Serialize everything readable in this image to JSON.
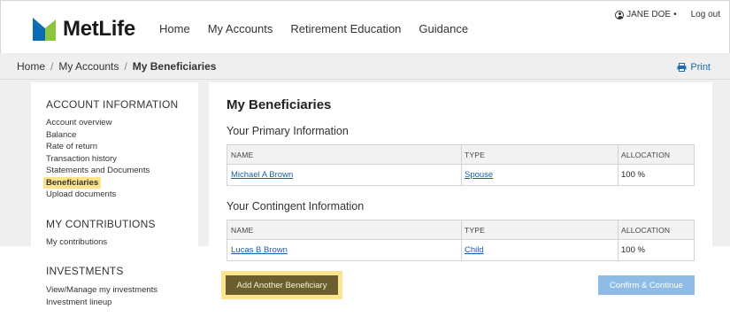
{
  "brand": {
    "name": "MetLife",
    "primary_blue": "#0a6bb4",
    "green": "#8bc63e"
  },
  "nav": {
    "items": [
      "Home",
      "My Accounts",
      "Retirement Education",
      "Guidance"
    ]
  },
  "user": {
    "name": "JANE DOE",
    "name_suffix": "•",
    "logout": "Log out"
  },
  "breadcrumb": {
    "home": "Home",
    "sep1": "/",
    "accounts": "My Accounts",
    "sep2": "/",
    "current": "My Beneficiaries"
  },
  "print_label": "Print",
  "sidebar": {
    "sections": [
      {
        "heading": "ACCOUNT INFORMATION",
        "items": [
          "Account overview",
          "Balance",
          "Rate of return",
          "Transaction history",
          "Statements and Documents",
          "Beneficiaries",
          "Upload documents"
        ],
        "active": "Beneficiaries"
      },
      {
        "heading": "MY CONTRIBUTIONS",
        "items": [
          "My contributions"
        ]
      },
      {
        "heading": "INVESTMENTS",
        "items": [
          "View/Manage my investments",
          "Investment lineup"
        ]
      }
    ]
  },
  "main": {
    "title": "My Beneficiaries",
    "primary": {
      "heading": "Your Primary Information",
      "columns": [
        "NAME",
        "TYPE",
        "ALLOCATION"
      ],
      "rows": [
        {
          "name": "Michael A Brown",
          "type": "Spouse",
          "allocation": "100 %"
        }
      ]
    },
    "contingent": {
      "heading": "Your Contingent Information",
      "columns": [
        "NAME",
        "TYPE",
        "ALLOCATION"
      ],
      "rows": [
        {
          "name": "Lucas B Brown",
          "type": "Child",
          "allocation": "100 %"
        }
      ]
    },
    "add_button": "Add Another Beneficiary",
    "confirm_button": "Confirm & Continue"
  }
}
